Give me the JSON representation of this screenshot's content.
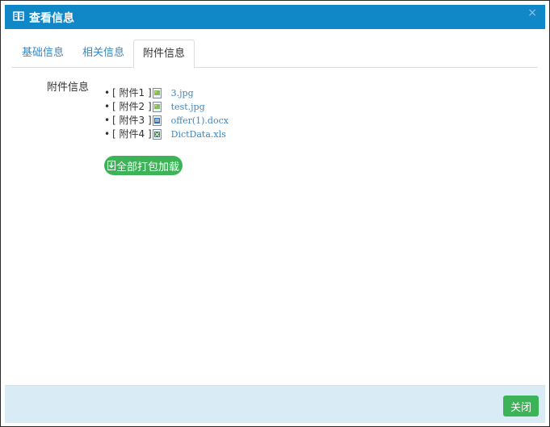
{
  "dialog": {
    "title": "查看信息",
    "close_glyph": "×"
  },
  "tabs": [
    {
      "label": "基础信息",
      "active": false
    },
    {
      "label": "相关信息",
      "active": false
    },
    {
      "label": "附件信息",
      "active": true
    }
  ],
  "attachments_section": {
    "label": "附件信息",
    "items": [
      {
        "label": "[ 附件1 ]",
        "icon": "image-file-icon",
        "file": "3.jpg"
      },
      {
        "label": "[ 附件2 ]",
        "icon": "image-file-icon",
        "file": "test.jpg"
      },
      {
        "label": "[ 附件3 ]",
        "icon": "word-file-icon",
        "file": "offer(1).docx"
      },
      {
        "label": "[ 附件4 ]",
        "icon": "excel-file-icon",
        "file": "DictData.xls"
      }
    ],
    "download_all_label": "全部打包加载"
  },
  "footer": {
    "close_label": "关闭"
  },
  "colors": {
    "titlebar": "#1088c8",
    "link": "#3d86c0",
    "button_green": "#3cb356",
    "footer_bg": "#d9ebf5"
  }
}
